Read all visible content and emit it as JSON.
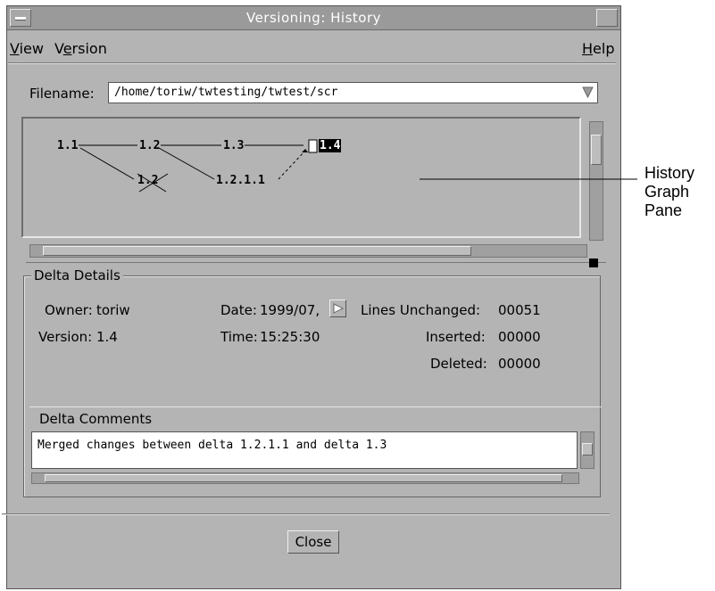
{
  "window": {
    "title": "Versioning: History"
  },
  "menubar": {
    "view": {
      "u": "V",
      "rest": "iew"
    },
    "version": {
      "a": "V",
      "u": "e",
      "rest": "rsion"
    },
    "help": {
      "u": "H",
      "rest": "elp"
    }
  },
  "filename": {
    "label": "Filename:",
    "value": "/home/toriw/twtesting/twtest/scr"
  },
  "graph": {
    "nodes": [
      "1.1",
      "1.2",
      "1.3",
      "1.4",
      "1.2",
      "1.2.1.1"
    ]
  },
  "delta": {
    "group_label": "Delta Details",
    "owner_label": "Owner:",
    "owner": "toriw",
    "version_label": "Version:",
    "version": "1.4",
    "date_label": "Date:",
    "date": "1999/07,",
    "time_label": "Time:",
    "time": "15:25:30",
    "unchanged_label": "Lines Unchanged:",
    "unchanged": "00051",
    "inserted_label": "Inserted:",
    "inserted": "00000",
    "deleted_label": "Deleted:",
    "deleted": "00000",
    "comments_label": "Delta Comments",
    "comments": "Merged changes between delta 1.2.1.1 and delta 1.3"
  },
  "close_label": "Close",
  "callout": {
    "line1": "History",
    "line2": "Graph",
    "line3": "Pane"
  }
}
